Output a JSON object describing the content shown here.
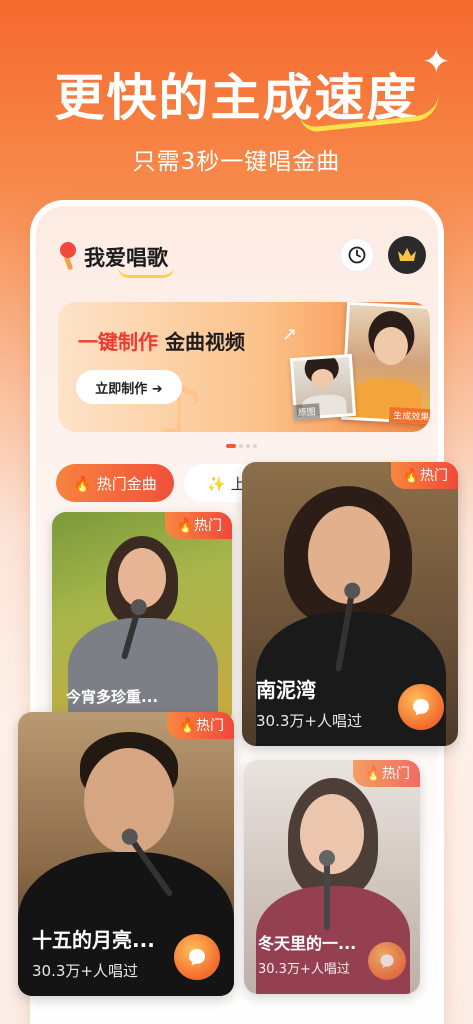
{
  "promo": {
    "headline": "更快的主成速度",
    "subtitle": "只需3秒一键唱金曲"
  },
  "app": {
    "title": "我爱唱歌"
  },
  "banner": {
    "title_accent": "一键制作",
    "title_rest": " 金曲视频",
    "cta": "立即制作 ➜",
    "original_label": "原图",
    "result_label": "生成效果"
  },
  "tabs": [
    {
      "label": "🔥 热门金曲",
      "active": true
    },
    {
      "label": "✨ 上新",
      "active": false
    },
    {
      "label": "",
      "active": false
    }
  ],
  "cards": [
    {
      "title": "今宵多珍重...",
      "badge": "🔥热门",
      "plays": ""
    },
    {
      "title": "南泥湾",
      "badge": "🔥热门",
      "plays": "30.3万+人唱过"
    },
    {
      "title": "十五的月亮...",
      "badge": "🔥热门",
      "plays": "30.3万+人唱过"
    },
    {
      "title": "冬天里的一...",
      "badge": "🔥热门",
      "plays": "30.3万+人唱过"
    }
  ],
  "colors": {
    "accent": "#f2503a",
    "highlight": "#ffd23a"
  },
  "icons": {
    "history": "clock-icon",
    "vip": "crown-icon",
    "sing": "chat-bubble-icon"
  }
}
